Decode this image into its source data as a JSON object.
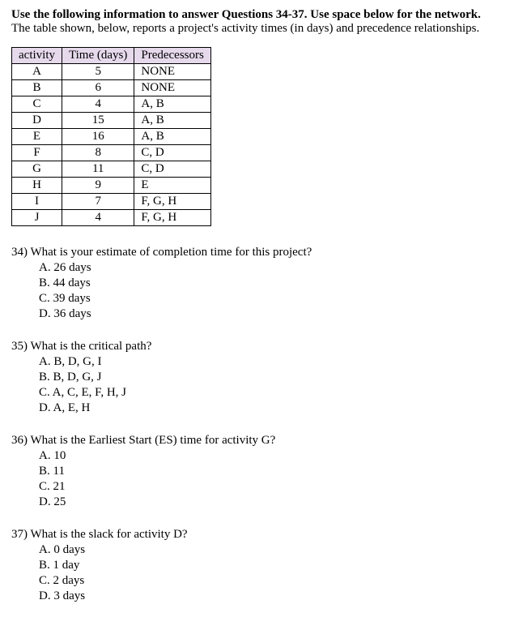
{
  "header": {
    "bold": "Use the following information to answer Questions 34-37. Use space below for the network.",
    "sub": "The table shown, below, reports a project's activity times (in days) and precedence relationships."
  },
  "table": {
    "headers": {
      "activity": "activity",
      "time": "Time (days)",
      "pred": "Predecessors"
    },
    "rows": [
      {
        "activity": "A",
        "time": "5",
        "pred": "NONE"
      },
      {
        "activity": "B",
        "time": "6",
        "pred": "NONE"
      },
      {
        "activity": "C",
        "time": "4",
        "pred": "A, B"
      },
      {
        "activity": "D",
        "time": "15",
        "pred": "A, B"
      },
      {
        "activity": "E",
        "time": "16",
        "pred": "A, B"
      },
      {
        "activity": "F",
        "time": "8",
        "pred": "C, D"
      },
      {
        "activity": "G",
        "time": "11",
        "pred": "C, D"
      },
      {
        "activity": "H",
        "time": "9",
        "pred": "E"
      },
      {
        "activity": "I",
        "time": "7",
        "pred": "F, G, H"
      },
      {
        "activity": "J",
        "time": "4",
        "pred": "F, G, H"
      }
    ]
  },
  "questions": [
    {
      "prompt": "34) What is your estimate of completion time for this project?",
      "options": [
        "A.  26 days",
        "B.  44 days",
        "C.  39 days",
        "D.  36 days"
      ]
    },
    {
      "prompt": "35) What is the critical path?",
      "options": [
        "A.  B, D, G, I",
        "B.  B, D, G, J",
        "C.  A, C, E, F, H, J",
        "D.  A, E, H"
      ]
    },
    {
      "prompt": "36) What is the Earliest Start (ES) time for activity G?",
      "options": [
        "A.  10",
        "B.  11",
        "C.  21",
        "D.  25"
      ]
    },
    {
      "prompt": "37) What is the slack for activity D?",
      "options": [
        "A.  0 days",
        "B.  1 day",
        "C.  2 days",
        "D.  3 days"
      ]
    }
  ]
}
